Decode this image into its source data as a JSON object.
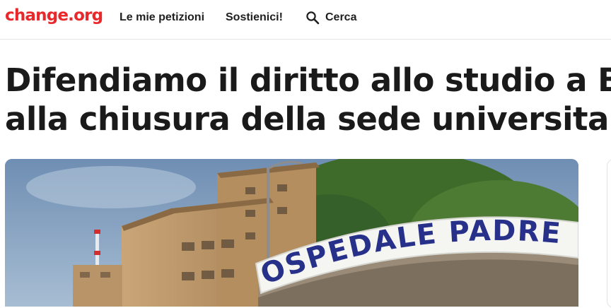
{
  "header": {
    "logo": "change.org",
    "nav": {
      "my_petitions": "Le mie petizioni",
      "support": "Sostienici!",
      "search": "Cerca"
    }
  },
  "petition": {
    "title_line1": "Difendiamo il diritto allo studio a Br",
    "title_line2": "alla chiusura della sede universitari",
    "image_sign_text": "OSPEDALE PADRE"
  },
  "colors": {
    "brand": "#e8282b",
    "sign_text": "#27318a"
  },
  "icons": {
    "search": "search-icon"
  }
}
